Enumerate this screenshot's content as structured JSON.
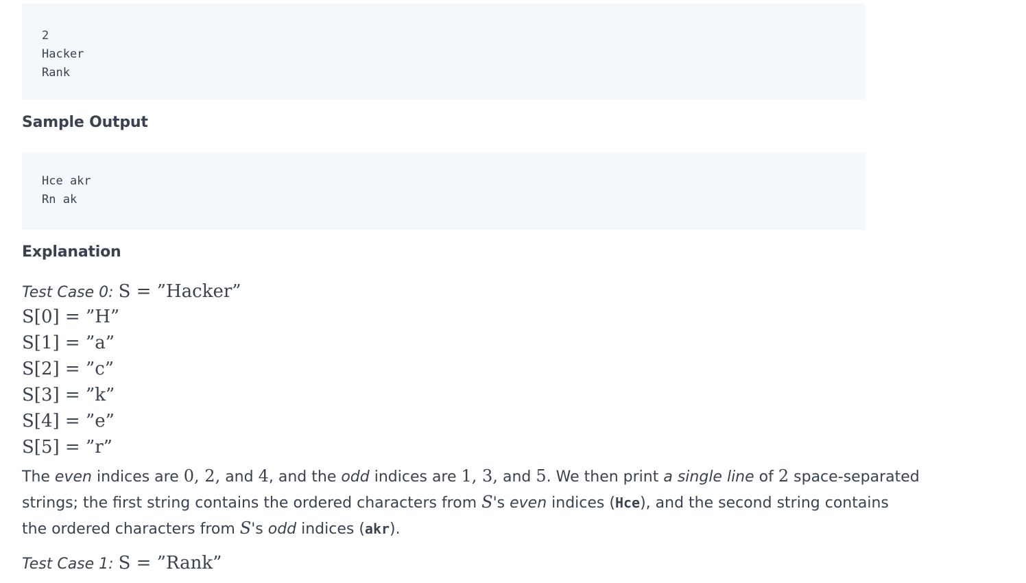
{
  "sample_input": {
    "lines": [
      "2",
      "Hacker",
      "Rank"
    ]
  },
  "sample_output": {
    "heading": "Sample Output",
    "lines": [
      "Hce akr",
      "Rn ak"
    ]
  },
  "explanation": {
    "heading": "Explanation",
    "test_case_0": {
      "label": "Test Case 0",
      "math": "S = ”Hacker”",
      "rows": [
        "S[0] = ”H”",
        "S[1] = ”a”",
        "S[2] = ”c”",
        "S[3] = ”k”",
        "S[4] = ”e”",
        "S[5] = ”r”"
      ],
      "para": {
        "l1_a": "The ",
        "l1_even": "even",
        "l1_b": " indices are ",
        "l1_m1": "0, 2,",
        "l1_c": " and ",
        "l1_m2": "4",
        "l1_d": ", and the ",
        "l1_odd": "odd",
        "l1_e": " indices are ",
        "l1_m3": "1, 3,",
        "l1_f": " and ",
        "l1_m4": "5",
        "l1_g": ". We then print ",
        "l1_single": "a single line",
        "l1_h": " of ",
        "l1_m5": "2",
        "l1_i": " space-separated",
        "l2_a": "strings; the first string contains the ordered characters from ",
        "l2_s": "S",
        "l2_b": "'s ",
        "l2_even": "even",
        "l2_c": " indices (",
        "l2_code": "Hce",
        "l2_d": "), and the second string contains",
        "l3_a": "the ordered characters from ",
        "l3_s": "S",
        "l3_b": "'s ",
        "l3_odd": "odd",
        "l3_c": " indices (",
        "l3_code": "akr",
        "l3_d": ")."
      }
    },
    "test_case_1": {
      "label": "Test Case 1",
      "math": "S = ”Rank”"
    }
  }
}
